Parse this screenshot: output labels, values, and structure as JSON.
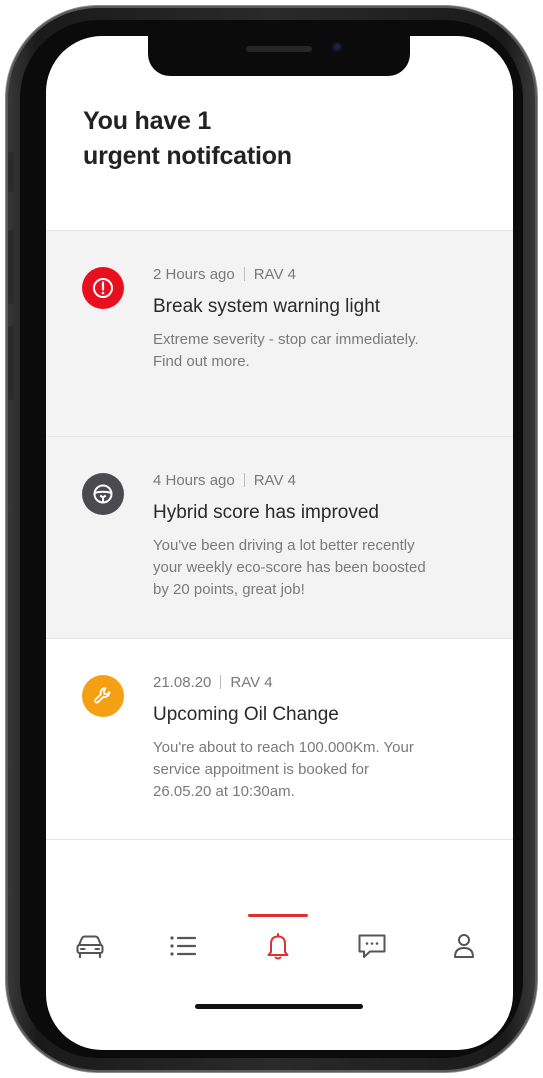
{
  "header": {
    "line1": "You have 1",
    "line2": "urgent notifcation"
  },
  "notifications": [
    {
      "time": "2 Hours ago",
      "vehicle": "RAV 4",
      "title": "Break system warning light",
      "description": "Extreme severity - stop car immediately.\nFind out more.",
      "icon": "alert-icon",
      "icon_color": "#e8101f",
      "shaded": true
    },
    {
      "time": "4 Hours ago",
      "vehicle": "RAV 4",
      "title": "Hybrid score has improved",
      "description": "You've been driving a lot better recently\nyour weekly eco-score has been boosted\nby 20 points, great job!",
      "icon": "steering-wheel-icon",
      "icon_color": "#4a4a4f",
      "shaded": true
    },
    {
      "time": "21.08.20",
      "vehicle": "RAV 4",
      "title": "Upcoming Oil Change",
      "description": "You're about to reach 100.000Km. Your\nservice appoitment is booked for\n26.05.20 at 10:30am.",
      "icon": "wrench-icon",
      "icon_color": "#f5a013",
      "shaded": false
    }
  ],
  "tabbar": {
    "active": "notifications",
    "accent": "#e02f2f",
    "items": [
      {
        "id": "car",
        "icon": "car-icon"
      },
      {
        "id": "list",
        "icon": "list-icon"
      },
      {
        "id": "notifications",
        "icon": "bell-icon"
      },
      {
        "id": "messages",
        "icon": "chat-bubble-icon"
      },
      {
        "id": "profile",
        "icon": "user-icon"
      }
    ]
  }
}
